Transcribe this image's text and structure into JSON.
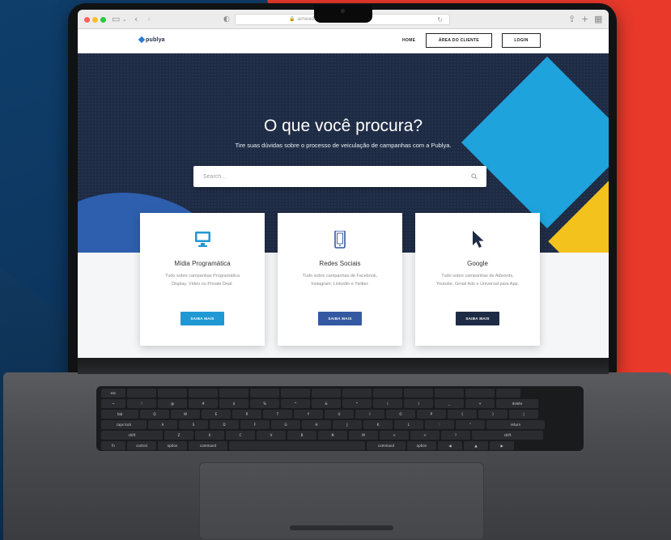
{
  "browser": {
    "address": "ameaduser",
    "icons": {
      "sidebar": "sidebar-icon",
      "back": "chevron-left-icon",
      "forward": "chevron-right-icon",
      "shield": "shield-icon",
      "lock": "lock-icon",
      "reload": "reload-icon",
      "share": "share-icon",
      "new_tab": "plus-icon",
      "tabs": "grid-icon"
    }
  },
  "nav": {
    "logo": "publya",
    "home": "HOME",
    "client_area": "ÁREA DO CLIENTE",
    "login": "LOGIN"
  },
  "hero": {
    "title": "O que você procura?",
    "subtitle": "Tire suas dúvidas sobre o processo de veiculação de campanhas com a Publya.",
    "search_placeholder": "Search..."
  },
  "cards": [
    {
      "icon": "monitor-icon",
      "title": "Mídia Programática",
      "description": "Tudo sobre campanhas Programática Display, Vídeo ou Private Deal.",
      "button": "SAIBA MAIS",
      "button_color": "#1f98d4"
    },
    {
      "icon": "smartphone-icon",
      "title": "Redes Sociais",
      "description": "Tudo sobre campanhas de Facebook, Instagram, Linkedin e Twitter.",
      "button": "SAIBA MAIS",
      "button_color": "#3558a3"
    },
    {
      "icon": "cursor-icon",
      "title": "Google",
      "description": "Tudo sobre campanhas de Adwords, Youtube, Gmail Ads e Universal para App.",
      "button": "SAIBA MAIS",
      "button_color": "#1e2b44"
    }
  ],
  "keyboard": {
    "row1": [
      "esc",
      "",
      "",
      "",
      "",
      "",
      "",
      "",
      "",
      "",
      "",
      "",
      "",
      ""
    ],
    "row2": [
      "~",
      "!",
      "@",
      "#",
      "$",
      "%",
      "^",
      "&",
      "*",
      "(",
      ")",
      "_",
      "+",
      "delete"
    ],
    "row3": [
      "tab",
      "Q",
      "W",
      "E",
      "R",
      "T",
      "Y",
      "U",
      "I",
      "O",
      "P",
      "{",
      "}",
      "|"
    ],
    "row4": [
      "caps lock",
      "A",
      "S",
      "D",
      "F",
      "G",
      "H",
      "J",
      "K",
      "L",
      ":",
      "\"",
      "return"
    ],
    "row5": [
      "shift",
      "Z",
      "X",
      "C",
      "V",
      "B",
      "N",
      "M",
      "<",
      ">",
      "?",
      "shift"
    ],
    "row6": [
      "fn",
      "control",
      "option",
      "command",
      "",
      "command",
      "option",
      "◀",
      "▲",
      "▶"
    ]
  },
  "colors": {
    "hero_bg": "#1e2b44",
    "accent_blue": "#1fa3dc",
    "accent_yellow": "#f4c21d",
    "backdrop_red": "#e8392b",
    "backdrop_navy": "#0d3a63"
  }
}
